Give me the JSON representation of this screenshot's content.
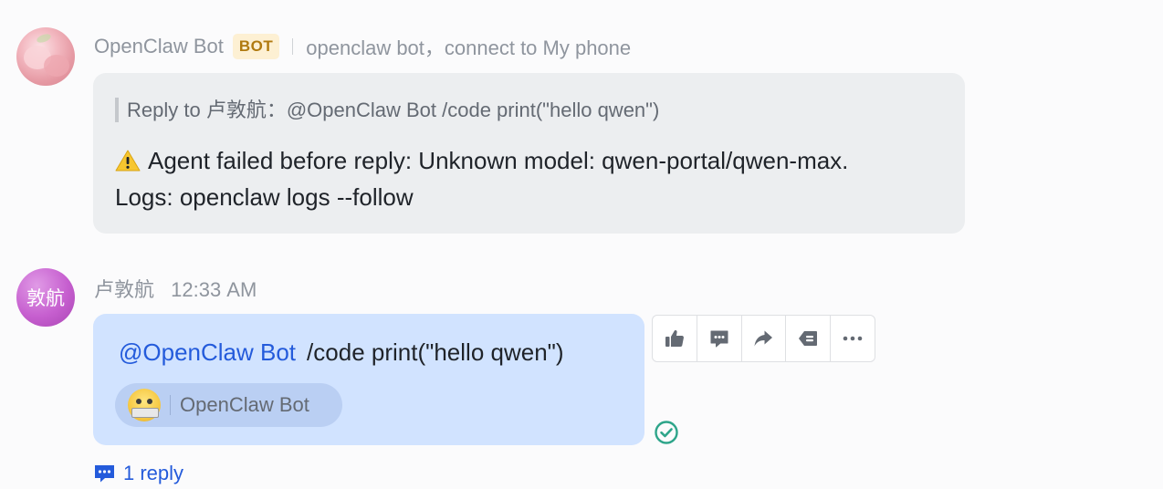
{
  "bot_message": {
    "sender": "OpenClaw Bot",
    "badge": "BOT",
    "group_desc": "openclaw bot，connect to My phone",
    "quote": "Reply to 卢敦航：@OpenClaw Bot /code print(\"hello qwen\")",
    "error_line1": "Agent failed before reply: Unknown model: qwen-portal/qwen-max.",
    "error_line2": "Logs: openclaw logs --follow"
  },
  "user_message": {
    "avatar_text": "敦航",
    "sender": "卢敦航",
    "time": "12:33 AM",
    "mention": "@OpenClaw Bot",
    "text": "/code print(\"hello qwen\")",
    "chip_name": "OpenClaw Bot",
    "reply_count": "1 reply"
  },
  "actions": [
    {
      "icon": "thumbs-up-icon"
    },
    {
      "icon": "comment-icon"
    },
    {
      "icon": "forward-icon"
    },
    {
      "icon": "delete-left-icon"
    },
    {
      "icon": "more-icon"
    }
  ],
  "colors": {
    "accent": "#245bdb",
    "bot_bubble": "#eceef0",
    "user_bubble": "#d1e3ff",
    "badge_bg": "#fdf0d3",
    "badge_text": "#b07a10",
    "read_check": "#2ea58a"
  }
}
